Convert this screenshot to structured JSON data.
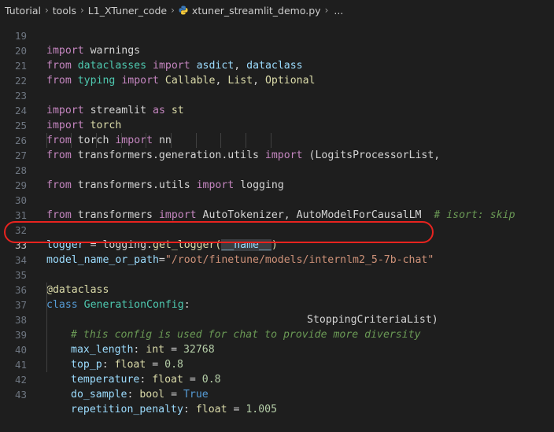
{
  "breadcrumb": {
    "items": [
      "Tutorial",
      "tools",
      "L1_XTuner_code"
    ],
    "file": "xtuner_streamlit_demo.py",
    "ellipsis": "..."
  },
  "lines": [
    {
      "n": "19"
    },
    {
      "n": "20"
    },
    {
      "n": "21"
    },
    {
      "n": "22"
    },
    {
      "n": "23"
    },
    {
      "n": "24"
    },
    {
      "n": "25"
    },
    {
      "n": "26"
    },
    {
      "n": "27"
    },
    {
      "n": "28"
    },
    {
      "n": "29"
    },
    {
      "n": "30"
    },
    {
      "n": "31"
    },
    {
      "n": "32"
    },
    {
      "n": "33"
    },
    {
      "n": "34"
    },
    {
      "n": "35"
    },
    {
      "n": "36"
    },
    {
      "n": "37"
    },
    {
      "n": "38"
    },
    {
      "n": "39"
    },
    {
      "n": "40"
    },
    {
      "n": "41"
    },
    {
      "n": "42"
    },
    {
      "n": "43"
    }
  ],
  "code": {
    "l19": {
      "kw": "import",
      "mod": "warnings"
    },
    "l20": {
      "kw1": "from",
      "mod": "dataclasses",
      "kw2": "import",
      "a": "asdict",
      "sep": ", ",
      "b": "dataclass"
    },
    "l21": {
      "kw1": "from",
      "mod": "typing",
      "kw2": "import",
      "a": "Callable",
      "sep1": ", ",
      "b": "List",
      "sep2": ", ",
      "c": "Optional"
    },
    "l23": {
      "kw1": "import",
      "mod": "streamlit",
      "kw2": "as",
      "alias": "st"
    },
    "l24": {
      "kw": "import",
      "mod": "torch"
    },
    "l25": {
      "kw1": "from",
      "mod": "torch",
      "kw2": "import",
      "a": "nn"
    },
    "l26": {
      "kw1": "from",
      "mod": "transformers.generation.utils",
      "kw2": "import",
      "a": "(LogitsProcessorList,"
    },
    "l27": {
      "a": "StoppingCriteriaList)"
    },
    "l28": {
      "kw1": "from",
      "mod": "transformers.utils",
      "kw2": "import",
      "a": "logging"
    },
    "l30": {
      "kw1": "from",
      "mod": "transformers",
      "kw2": "import",
      "a": "AutoTokenizer",
      "sep": ", ",
      "b": "AutoModelForCausalLM",
      "cmt": "# isort: skip"
    },
    "l32": {
      "var": "logger",
      "eq": " = ",
      "obj": "logging",
      "dot": ".",
      "fn": "get_logger",
      "open": "(",
      "arg": "__name__",
      "close": ")"
    },
    "l33": {
      "var": "model_name_or_path",
      "eq": "=",
      "str": "\"/root/finetune/models/internlm2_5-7b-chat\""
    },
    "l35": {
      "dec": "@dataclass"
    },
    "l36": {
      "kw": "class",
      "cls": "GenerationConfig",
      "colon": ":"
    },
    "l37": {
      "cmt": "# this config is used for chat to provide more diversity"
    },
    "l38": {
      "var": "max_length",
      "colon": ": ",
      "type": "int",
      "eq": " = ",
      "val": "32768"
    },
    "l39": {
      "var": "top_p",
      "colon": ": ",
      "type": "float",
      "eq": " = ",
      "val": "0.8"
    },
    "l40": {
      "var": "temperature",
      "colon": ": ",
      "type": "float",
      "eq": " = ",
      "val": "0.8"
    },
    "l41": {
      "var": "do_sample",
      "colon": ": ",
      "type": "bool",
      "eq": " = ",
      "val": "True"
    },
    "l42": {
      "var": "repetition_penalty",
      "colon": ": ",
      "type": "float",
      "eq": " = ",
      "val": "1.005"
    }
  },
  "colors": {
    "background": "#1e1e1e",
    "keyword": "#c586c0",
    "module": "#4ec9b0",
    "function": "#dcdcaa",
    "variable": "#9cdcfe",
    "string": "#ce9178",
    "number": "#b5cea8",
    "comment": "#6a9955",
    "annotation_oval": "#e8231f"
  },
  "icons": {
    "file_icon": "python-file-icon",
    "separator": "chevron-right-icon"
  }
}
